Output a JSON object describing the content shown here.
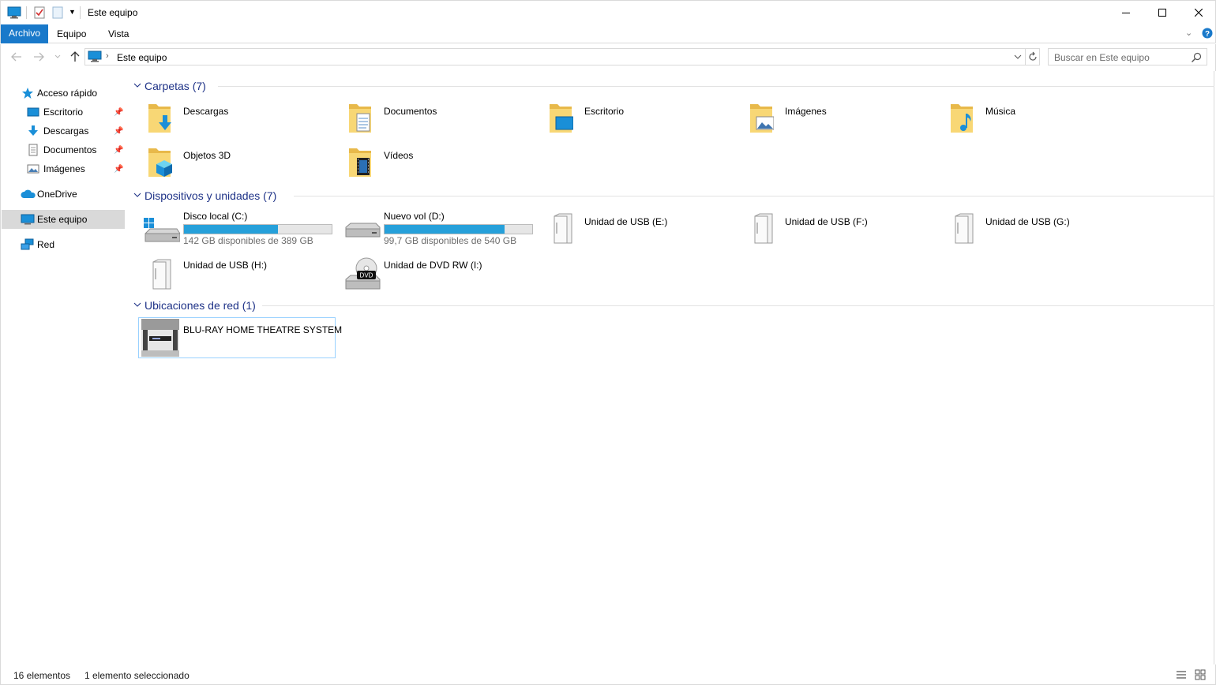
{
  "window": {
    "title": "Este equipo",
    "controls": {
      "minimize": "minimize-icon",
      "maximize": "maximize-icon",
      "close": "close-icon"
    }
  },
  "ribbon": {
    "tabs": [
      {
        "label": "Archivo",
        "active": true
      },
      {
        "label": "Equipo",
        "active": false
      },
      {
        "label": "Vista",
        "active": false
      }
    ]
  },
  "address": {
    "path": "Este equipo",
    "search_placeholder": "Buscar en Este equipo"
  },
  "sidebar": {
    "items": [
      {
        "label": "Acceso rápido",
        "icon": "star-icon"
      },
      {
        "label": "Escritorio",
        "icon": "desktop-icon",
        "pinned": true
      },
      {
        "label": "Descargas",
        "icon": "download-icon",
        "pinned": true
      },
      {
        "label": "Documentos",
        "icon": "document-icon",
        "pinned": true
      },
      {
        "label": "Imágenes",
        "icon": "image-icon",
        "pinned": true
      },
      {
        "label": "OneDrive",
        "icon": "cloud-icon"
      },
      {
        "label": "Este equipo",
        "icon": "computer-icon",
        "selected": true
      },
      {
        "label": "Red",
        "icon": "network-icon"
      }
    ]
  },
  "groups": {
    "folders": {
      "title": "Carpetas (7)",
      "items": [
        {
          "name": "Descargas",
          "icon": "download-folder-icon"
        },
        {
          "name": "Documentos",
          "icon": "documents-folder-icon"
        },
        {
          "name": "Escritorio",
          "icon": "desktop-folder-icon"
        },
        {
          "name": "Imágenes",
          "icon": "pictures-folder-icon"
        },
        {
          "name": "Música",
          "icon": "music-folder-icon"
        },
        {
          "name": "Objetos 3D",
          "icon": "3d-objects-folder-icon"
        },
        {
          "name": "Vídeos",
          "icon": "videos-folder-icon"
        }
      ]
    },
    "devices": {
      "title": "Dispositivos y unidades (7)",
      "items": [
        {
          "name": "Disco local (C:)",
          "sub": "142 GB disponibles de 389 GB",
          "used_fraction": 0.635,
          "icon": "windows-drive-icon"
        },
        {
          "name": "Nuevo vol (D:)",
          "sub": "99,7 GB disponibles de 540 GB",
          "used_fraction": 0.815,
          "icon": "hard-drive-icon"
        },
        {
          "name": "Unidad de USB (E:)",
          "icon": "usb-drive-icon"
        },
        {
          "name": "Unidad de USB (F:)",
          "icon": "usb-drive-icon"
        },
        {
          "name": "Unidad de USB (G:)",
          "icon": "usb-drive-icon"
        },
        {
          "name": "Unidad de USB (H:)",
          "icon": "usb-drive-icon"
        },
        {
          "name": "Unidad de DVD RW (I:)",
          "icon": "dvd-drive-icon",
          "badge": "DVD"
        }
      ]
    },
    "network": {
      "title": "Ubicaciones de red (1)",
      "items": [
        {
          "name": "BLU-RAY HOME THEATRE SYSTEM",
          "icon": "media-device-icon",
          "selected": true
        }
      ]
    }
  },
  "status": {
    "count": "16 elementos",
    "selection": "1 elemento seleccionado"
  },
  "colors": {
    "accent": "#1979ca",
    "group_title": "#1e3287",
    "bar_fill": "#26a0da",
    "folder_yellow": "#f8d775"
  }
}
